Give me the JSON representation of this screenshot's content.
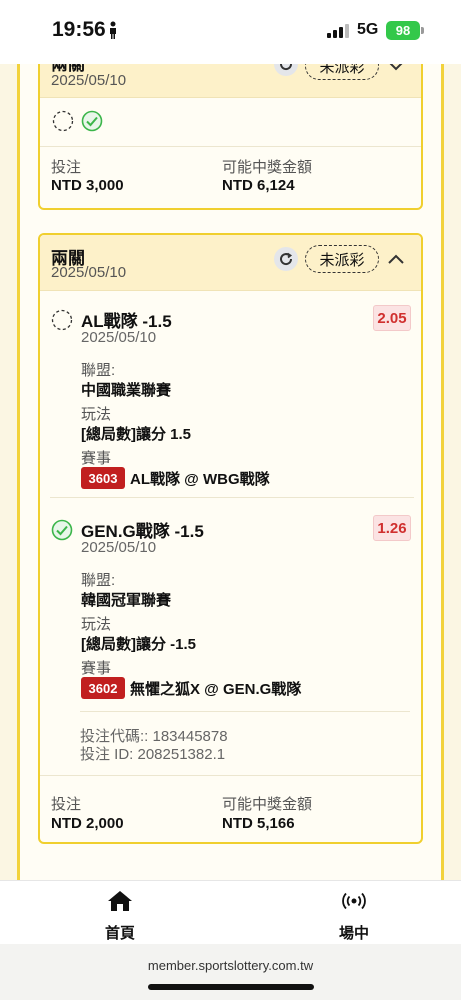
{
  "status_bar": {
    "time": "19:56",
    "network": "5G",
    "battery": "98"
  },
  "cards": [
    {
      "bet_type": "兩關",
      "date": "2025/05/10",
      "status": "未派彩",
      "stake_label": "投注",
      "stake_value": "NTD 3,000",
      "payout_label": "可能中獎金額",
      "payout_value": "NTD 6,124"
    },
    {
      "bet_type": "兩關",
      "date": "2025/05/10",
      "status": "未派彩",
      "selections": [
        {
          "name": "AL戰隊 -1.5",
          "date": "2025/05/10",
          "odds": "2.05",
          "league_label": "聯盟:",
          "league": "中國職業聯賽",
          "market_label": "玩法",
          "market": "[總局數]讓分 1.5",
          "event_label": "賽事",
          "event_id": "3603",
          "event": "AL戰隊 @ WBG戰隊",
          "result": "pending"
        },
        {
          "name": "GEN.G戰隊 -1.5",
          "date": "2025/05/10",
          "odds": "1.26",
          "league_label": "聯盟:",
          "league": "韓國冠軍聯賽",
          "market_label": "玩法",
          "market": "[總局數]讓分 -1.5",
          "event_label": "賽事",
          "event_id": "3602",
          "event": "無懼之狐X @ GEN.G戰隊",
          "result": "won"
        }
      ],
      "bet_code": "投注代碼:: 183445878",
      "bet_id": "投注 ID: 208251382.1",
      "stake_label": "投注",
      "stake_value": "NTD 2,000",
      "payout_label": "可能中獎金額",
      "payout_value": "NTD 5,166"
    }
  ],
  "bottom_nav": {
    "home_label": "首頁",
    "live_label": "場中"
  },
  "url": "member.sportslottery.com.tw",
  "colors": {
    "accent_yellow": "#f2d23c",
    "header_bg": "#fdf1c9",
    "odds_red": "#d0302f",
    "badge_red": "#c11f1f",
    "won_green": "#3bb54a"
  }
}
